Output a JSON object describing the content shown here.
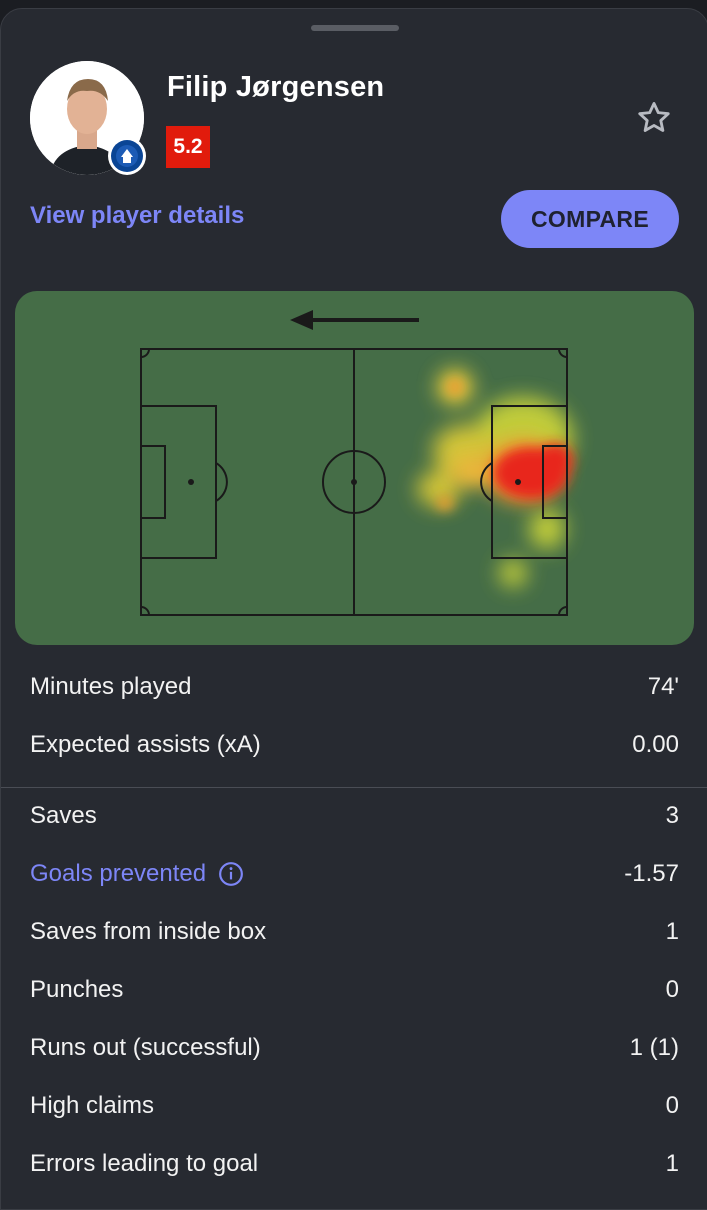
{
  "player": {
    "name": "Filip Jørgensen",
    "rating": "5.2",
    "avatar_icon": "player-avatar",
    "club_badge_icon": "chelsea-badge-icon"
  },
  "actions": {
    "view_details_label": "View player details",
    "compare_label": "COMPARE",
    "favorite_icon": "star-icon"
  },
  "heatmap": {
    "attack_direction": "left",
    "hotspot_colors": [
      "#e8271f",
      "#f3d43a"
    ]
  },
  "stats_group_1": [
    {
      "label": "Minutes played",
      "value": "74'"
    },
    {
      "label": "Expected assists (xA)",
      "value": "0.00"
    }
  ],
  "stats_group_2": [
    {
      "label": "Saves",
      "value": "3"
    },
    {
      "label": "Goals prevented",
      "value": "-1.57"
    },
    {
      "label": "Saves from inside box",
      "value": "1"
    },
    {
      "label": "Punches",
      "value": "0"
    },
    {
      "label": "Runs out (successful)",
      "value": "1 (1)"
    },
    {
      "label": "High claims",
      "value": "0"
    },
    {
      "label": "Errors leading to goal",
      "value": "1"
    }
  ],
  "colors": {
    "accent": "#7d86f7",
    "rating_bg": "#e11b0c",
    "pitch": "#456d47",
    "background": "#272a31"
  }
}
